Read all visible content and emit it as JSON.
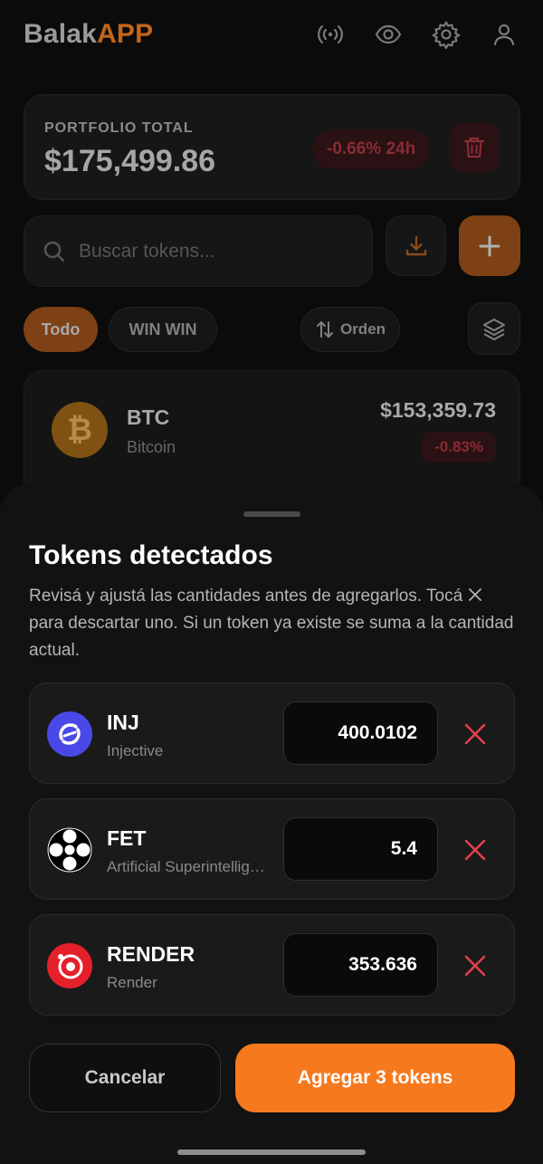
{
  "app": {
    "logo_part1": "Balak",
    "logo_part2": "APP",
    "header_icons": [
      "broadcast-icon",
      "eye-icon",
      "gear-icon",
      "user-icon"
    ]
  },
  "portfolio": {
    "label": "PORTFOLIO TOTAL",
    "value": "$175,499.86",
    "change": "-0.66% 24h"
  },
  "search": {
    "placeholder": "Buscar tokens..."
  },
  "filters": {
    "all": "Todo",
    "win": "WIN WIN",
    "order": "Orden"
  },
  "holding": {
    "symbol": "BTC",
    "name": "Bitcoin",
    "value": "$153,359.73",
    "change": "-0.83%"
  },
  "sheet": {
    "title": "Tokens detectados",
    "desc_part1": "Revisá y ajustá las cantidades antes de agregarlos. Tocá",
    "desc_part2": "para descartar uno. Si un token ya existe se suma a la cantidad actual.",
    "tokens": [
      {
        "symbol": "INJ",
        "name": "Injective",
        "amount": "400.0102"
      },
      {
        "symbol": "FET",
        "name": "Artificial Superintelligence Alliance",
        "amount": "5.4"
      },
      {
        "symbol": "RENDER",
        "name": "Render",
        "amount": "353.636"
      }
    ],
    "cancel_label": "Cancelar",
    "add_label": "Agregar 3 tokens"
  },
  "colors": {
    "accent": "#f7791e",
    "danger": "#e0404b",
    "sheet_bg": "#121212"
  }
}
